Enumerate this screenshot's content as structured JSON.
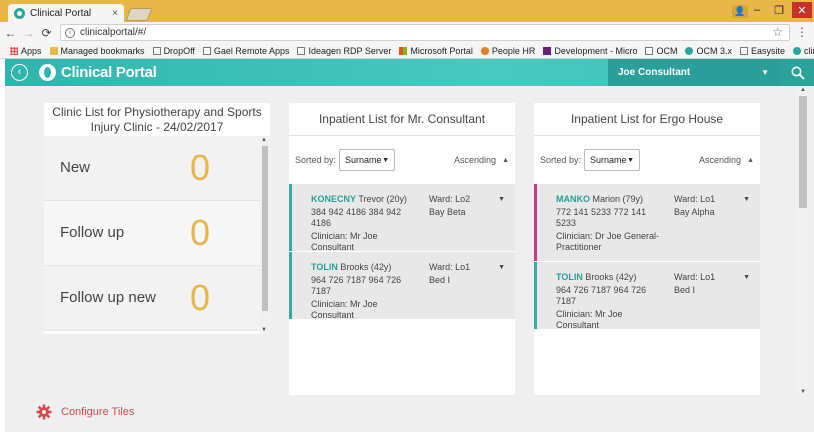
{
  "browser": {
    "tab_title": "Clinical Portal",
    "tab_close": "×",
    "url": "clinicalportal/#/",
    "window_controls": {
      "minimize": "–",
      "maximize": "❐",
      "close": "✕"
    },
    "bookmarks": [
      {
        "label": "Apps",
        "icon": "apps"
      },
      {
        "label": "Managed bookmarks",
        "icon": "folder"
      },
      {
        "label": "DropOff",
        "icon": "page"
      },
      {
        "label": "Gael Remote Apps",
        "icon": "page"
      },
      {
        "label": "Ideagen RDP Server",
        "icon": "page"
      },
      {
        "label": "Microsoft Portal",
        "icon": "ms"
      },
      {
        "label": "People HR",
        "icon": "hr"
      },
      {
        "label": "Development - Micro",
        "icon": "vs"
      },
      {
        "label": "OCM",
        "icon": "page"
      },
      {
        "label": "OCM 3.x",
        "icon": "cp"
      },
      {
        "label": "Easysite",
        "icon": "page"
      },
      {
        "label": "clinicalportal",
        "icon": "cp"
      }
    ],
    "bookmarks_more": "»"
  },
  "header": {
    "brand": "Clinical Portal",
    "user": "Joe Consultant",
    "brand_color": "#2fb5ad"
  },
  "clinic_panel": {
    "title": "Clinic List for Physiotherapy and Sports Injury Clinic - 24/02/2017",
    "stats": [
      {
        "label": "New",
        "value": "0"
      },
      {
        "label": "Follow up",
        "value": "0"
      },
      {
        "label": "Follow up new",
        "value": "0"
      }
    ],
    "accent_color": "#e8b64a"
  },
  "inpatient_lists": [
    {
      "title": "Inpatient List for Mr. Consultant",
      "sort_label": "Sorted by:",
      "sort_value": "Surname",
      "direction": "Ascending",
      "patients": [
        {
          "surname": "KONECNY",
          "rest": "Trevor (20y)",
          "ids": "384 942 4186     384 942 4186",
          "clinician": "Clinician: Mr Joe Consultant",
          "ward": "Ward: Lo2",
          "bed": "Bay Beta",
          "flag": "teal"
        },
        {
          "surname": "TOLIN",
          "rest": "Brooks (42y)",
          "ids": "964 726 7187     964 726 7187",
          "clinician": "Clinician: Mr Joe Consultant",
          "ward": "Ward: Lo1",
          "bed": "Bed I",
          "flag": "teal"
        }
      ]
    },
    {
      "title": "Inpatient List for Ergo House",
      "sort_label": "Sorted by:",
      "sort_value": "Surname",
      "direction": "Ascending",
      "patients": [
        {
          "surname": "MANKO",
          "rest": "Marion (79y)",
          "ids": "772 141 5233     772 141 5233",
          "clinician": "Clinician: Dr Joe General-Practitioner",
          "ward": "Ward: Lo1",
          "bed": "Bay Alpha",
          "flag": "pink"
        },
        {
          "surname": "TOLIN",
          "rest": "Brooks (42y)",
          "ids": "964 726 7187     964 726 7187",
          "clinician": "Clinician: Mr Joe Consultant",
          "ward": "Ward: Lo1",
          "bed": "Bed I",
          "flag": "teal"
        }
      ]
    }
  ],
  "footer": {
    "configure_label": "Configure Tiles",
    "configure_color": "#d44b4b"
  }
}
